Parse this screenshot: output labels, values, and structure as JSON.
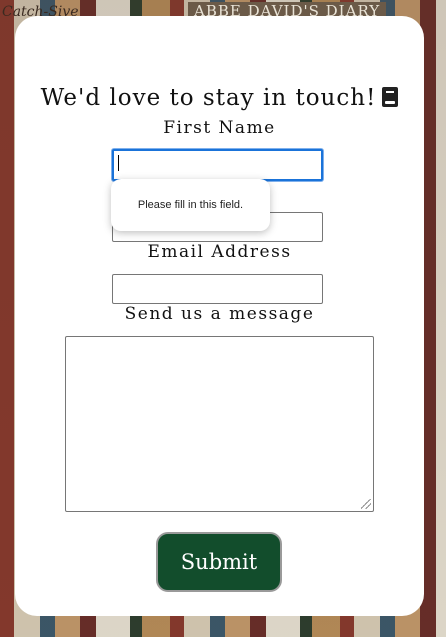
{
  "background": {
    "book_text_left": "Catch-Sive",
    "book_text_top": "ABBE DAVID'S DIARY"
  },
  "form": {
    "title": "We'd love to stay in touch!",
    "title_icon": "book-icon",
    "first_name_label": "First Name",
    "first_name_value": "",
    "last_name_value": "",
    "email_label": "Email Address",
    "email_value": "",
    "message_label": "Send us a message",
    "message_value": "",
    "submit_label": "Submit"
  },
  "validation": {
    "tooltip_text": "Please fill in this field."
  },
  "colors": {
    "submit_bg": "#124d2c",
    "focus_ring": "#1a73d9"
  }
}
